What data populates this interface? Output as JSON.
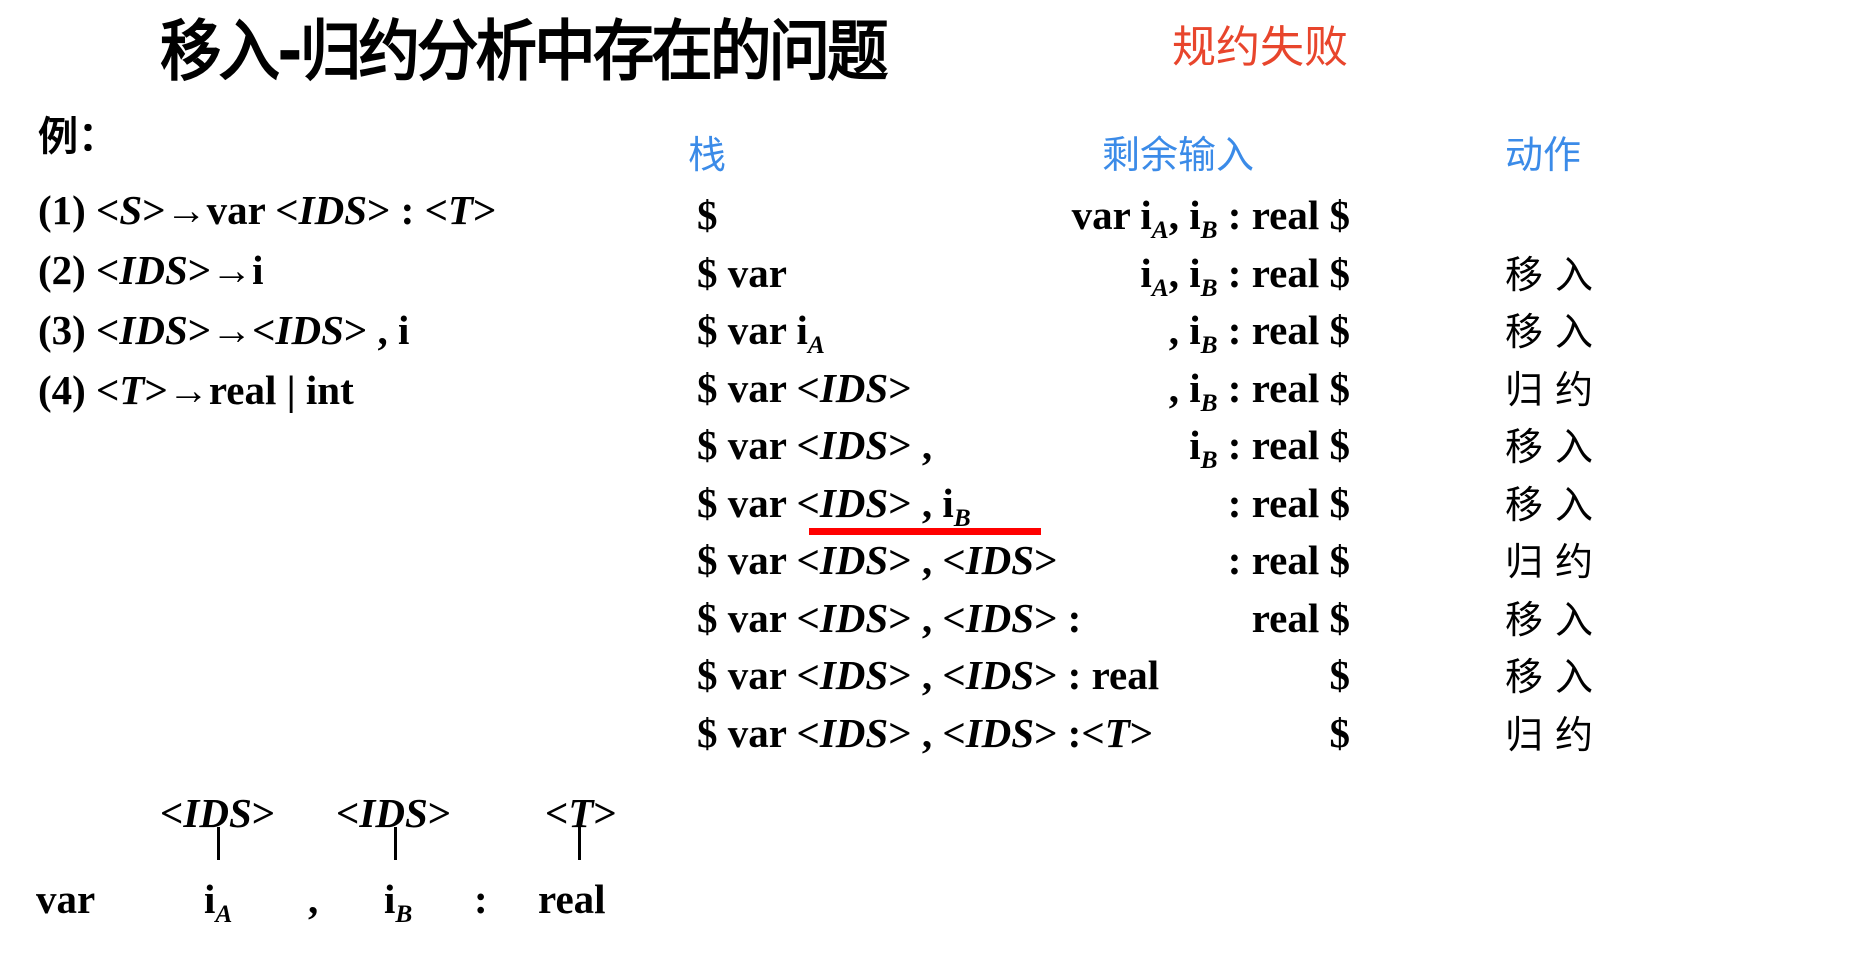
{
  "slide": {
    "title": "移入-归约分析中存在的问题",
    "tag": "规约失败",
    "colors": {
      "header_blue": "#3b8be8",
      "tag_red": "#e8452c",
      "underline_red": "#ff0000",
      "text": "#000000"
    }
  },
  "example": {
    "label": "例：",
    "productions": [
      [
        {
          "t": "(1) <"
        },
        {
          "t": "S",
          "i": true
        },
        {
          "t": ">→var <"
        },
        {
          "t": "IDS",
          "i": true
        },
        {
          "t": "> : <"
        },
        {
          "t": "T",
          "i": true
        },
        {
          "t": ">"
        }
      ],
      [
        {
          "t": "(2) <"
        },
        {
          "t": "IDS",
          "i": true
        },
        {
          "t": ">→i"
        }
      ],
      [
        {
          "t": "(3) <"
        },
        {
          "t": "IDS",
          "i": true
        },
        {
          "t": ">→<"
        },
        {
          "t": "IDS",
          "i": true
        },
        {
          "t": "> , i"
        }
      ],
      [
        {
          "t": "(4) <"
        },
        {
          "t": "T",
          "i": true
        },
        {
          "t": ">→real | int"
        }
      ]
    ]
  },
  "table": {
    "headers": {
      "stack": "栈",
      "input": "剩余输入",
      "action": "动作"
    },
    "rows": [
      {
        "stack": [
          {
            "t": "$"
          }
        ],
        "input": [
          {
            "t": "var i"
          },
          {
            "t": "A",
            "s": true
          },
          {
            "t": ", i"
          },
          {
            "t": "B",
            "s": true
          },
          {
            "t": " : real $"
          }
        ],
        "action": ""
      },
      {
        "stack": [
          {
            "t": "$ var"
          }
        ],
        "input": [
          {
            "t": "i"
          },
          {
            "t": "A",
            "s": true
          },
          {
            "t": ", i"
          },
          {
            "t": "B",
            "s": true
          },
          {
            "t": " : real $"
          }
        ],
        "action": "移入"
      },
      {
        "stack": [
          {
            "t": "$ var i"
          },
          {
            "t": "A",
            "s": true
          }
        ],
        "input": [
          {
            "t": ", i"
          },
          {
            "t": "B",
            "s": true
          },
          {
            "t": " : real $"
          }
        ],
        "action": "移入"
      },
      {
        "stack": [
          {
            "t": "$ var <"
          },
          {
            "t": "IDS",
            "i": true
          },
          {
            "t": ">"
          }
        ],
        "input": [
          {
            "t": ", i"
          },
          {
            "t": "B",
            "s": true
          },
          {
            "t": " : real $"
          }
        ],
        "action": "归约"
      },
      {
        "stack": [
          {
            "t": "$ var <"
          },
          {
            "t": "IDS",
            "i": true
          },
          {
            "t": "> ,"
          }
        ],
        "input": [
          {
            "t": "i"
          },
          {
            "t": "B",
            "s": true
          },
          {
            "t": " : real $"
          }
        ],
        "action": "移入"
      },
      {
        "stack": [
          {
            "t": "$ var <"
          },
          {
            "t": "IDS",
            "i": true
          },
          {
            "t": "> ,  i"
          },
          {
            "t": "B",
            "s": true
          }
        ],
        "input": [
          {
            "t": ": real $"
          }
        ],
        "action": "移入",
        "highlight": "<IDS> , i_B"
      },
      {
        "stack": [
          {
            "t": "$ var <"
          },
          {
            "t": "IDS",
            "i": true
          },
          {
            "t": "> , <"
          },
          {
            "t": "IDS",
            "i": true
          },
          {
            "t": ">"
          }
        ],
        "input": [
          {
            "t": ": real $"
          }
        ],
        "action": "归约"
      },
      {
        "stack": [
          {
            "t": "$ var <"
          },
          {
            "t": "IDS",
            "i": true
          },
          {
            "t": "> , <"
          },
          {
            "t": "IDS",
            "i": true
          },
          {
            "t": "> :"
          }
        ],
        "input": [
          {
            "t": "real $"
          }
        ],
        "action": "移入"
      },
      {
        "stack": [
          {
            "t": "$ var <"
          },
          {
            "t": "IDS",
            "i": true
          },
          {
            "t": "> , <"
          },
          {
            "t": "IDS",
            "i": true
          },
          {
            "t": "> : real"
          }
        ],
        "input": [
          {
            "t": "$"
          }
        ],
        "action": "移入"
      },
      {
        "stack": [
          {
            "t": "$ var <"
          },
          {
            "t": "IDS",
            "i": true
          },
          {
            "t": "> , <"
          },
          {
            "t": "IDS",
            "i": true
          },
          {
            "t": "> :<"
          },
          {
            "t": "T",
            "i": true
          },
          {
            "t": ">"
          }
        ],
        "input": [
          {
            "t": "$"
          }
        ],
        "action": "归约"
      }
    ]
  },
  "tree": {
    "parents": [
      [
        {
          "t": "<"
        },
        {
          "t": "IDS",
          "i": true
        },
        {
          "t": ">"
        }
      ],
      [
        {
          "t": "<"
        },
        {
          "t": "IDS",
          "i": true
        },
        {
          "t": ">"
        }
      ],
      [
        {
          "t": "<"
        },
        {
          "t": "T",
          "i": true
        },
        {
          "t": ">"
        }
      ]
    ],
    "leaves": [
      [
        {
          "t": "var"
        }
      ],
      [
        {
          "t": "i"
        },
        {
          "t": "A",
          "s": true
        }
      ],
      [
        {
          "t": ","
        }
      ],
      [
        {
          "t": "i"
        },
        {
          "t": "B",
          "s": true
        }
      ],
      [
        {
          "t": ":"
        }
      ],
      [
        {
          "t": "real"
        }
      ]
    ]
  }
}
